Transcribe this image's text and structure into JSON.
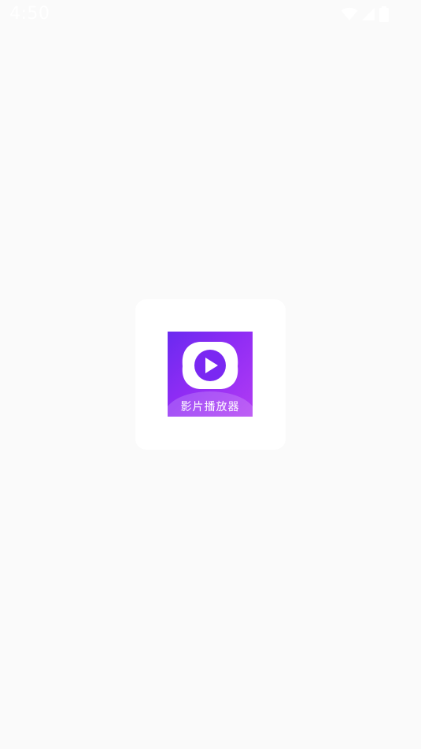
{
  "status_bar": {
    "time": "4:50",
    "icons": [
      "wifi-icon",
      "cellular-signal-icon",
      "battery-icon"
    ]
  },
  "splash": {
    "app_icon": "video-player-play-icon",
    "app_name": "影片播放器",
    "colors": {
      "background": "#fafafa",
      "card": "#ffffff",
      "icon_gradient_start": "#6a2af0",
      "icon_gradient_end": "#b13cf3"
    }
  }
}
